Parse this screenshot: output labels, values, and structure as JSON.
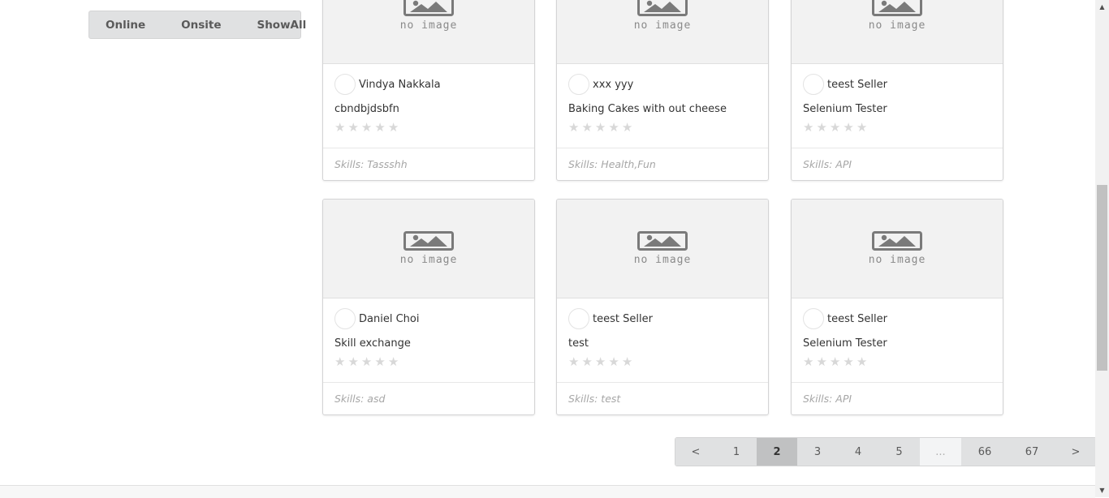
{
  "filters": {
    "online": "Online",
    "onsite": "Onsite",
    "show_all": "ShowAll"
  },
  "no_image_text": "no image",
  "cards": [
    {
      "seller": "Vindya Nakkala",
      "title": "cbndbjdsbfn",
      "skills": "Skills: Tassshh",
      "rating": 0
    },
    {
      "seller": "xxx yyy",
      "title": "Baking Cakes with out cheese",
      "skills": "Skills: Health,Fun",
      "rating": 0
    },
    {
      "seller": "teest Seller",
      "title": "Selenium Tester",
      "skills": "Skills: API",
      "rating": 0
    },
    {
      "seller": "Daniel Choi",
      "title": "Skill exchange",
      "skills": "Skills: asd",
      "rating": 0
    },
    {
      "seller": "teest Seller",
      "title": "test",
      "skills": "Skills: test",
      "rating": 0
    },
    {
      "seller": "teest Seller",
      "title": "Selenium Tester",
      "skills": "Skills: API",
      "rating": 0
    }
  ],
  "pagination": {
    "prev": "<",
    "pages": [
      "1",
      "2",
      "3",
      "4",
      "5"
    ],
    "ellipsis": "...",
    "tail_pages": [
      "66",
      "67"
    ],
    "next": ">",
    "current": "2"
  },
  "icons": {
    "placeholder": "image-placeholder-icon",
    "star": "star-icon",
    "scroll_up": "scroll-up-arrow-icon",
    "scroll_down": "scroll-down-arrow-icon"
  },
  "colors": {
    "button_bg": "#e0e1e2",
    "active_page_bg": "#c0c1c2",
    "star_empty": "#d8d8d8",
    "skills_text": "#a6a6a6"
  }
}
